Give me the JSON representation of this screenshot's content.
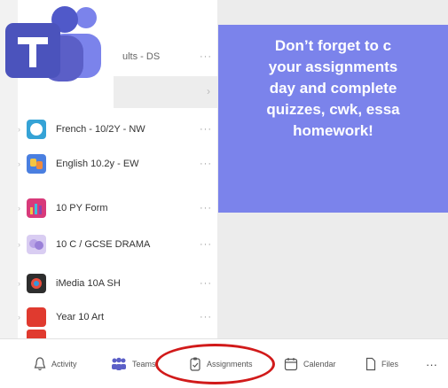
{
  "app": {
    "name": "Microsoft Teams"
  },
  "teams": [
    {
      "name": "ults - DS",
      "avatar_color": "#ffffff",
      "partial": true
    },
    {
      "name": "French - 10/2Y - NW",
      "avatar_color": "#35a3d6"
    },
    {
      "name": "English 10.2y - EW",
      "avatar_color": "#4a7fe0"
    },
    {
      "name": "10 PY Form",
      "avatar_color": "#d83a7a"
    },
    {
      "name": "10 C / GCSE DRAMA",
      "avatar_color": "#b9a3e6"
    },
    {
      "name": "iMedia 10A SH",
      "avatar_color": "#2d2d2d"
    },
    {
      "name": "Year 10 Art",
      "avatar_color": "#e03a2f"
    }
  ],
  "more_label": "···",
  "banner": {
    "lines": [
      "Don’t forget to c",
      "your assignments",
      "day and complete",
      "quizzes, cwk, essa",
      "homework!"
    ],
    "color": "#7b83eb"
  },
  "tabbar": {
    "tabs": [
      {
        "label": "Activity",
        "icon": "bell-icon"
      },
      {
        "label": "Teams",
        "icon": "teams-icon"
      },
      {
        "label": "Assignments",
        "icon": "assignments-icon",
        "highlighted": true
      },
      {
        "label": "Calendar",
        "icon": "calendar-icon"
      },
      {
        "label": "Files",
        "icon": "file-icon"
      }
    ],
    "more_label": "···"
  },
  "annotation_color": "#d11a1a"
}
